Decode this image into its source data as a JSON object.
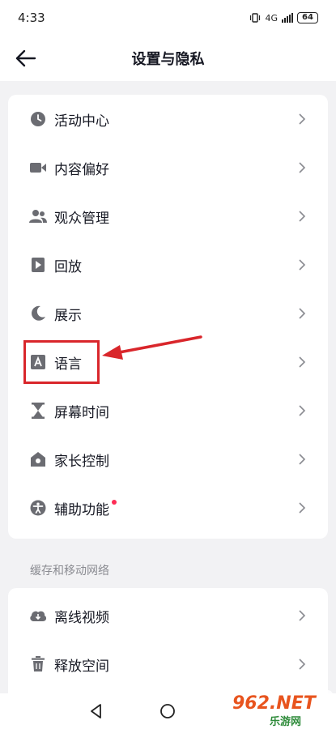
{
  "status_bar": {
    "time": "4:33",
    "network": "4G",
    "battery": "64"
  },
  "header": {
    "title": "设置与隐私"
  },
  "settings_items": [
    {
      "label": "活动中心",
      "icon": "clock-icon"
    },
    {
      "label": "内容偏好",
      "icon": "video-camera-icon"
    },
    {
      "label": "观众管理",
      "icon": "people-icon"
    },
    {
      "label": "回放",
      "icon": "play-icon"
    },
    {
      "label": "展示",
      "icon": "moon-icon"
    },
    {
      "label": "语言",
      "icon": "language-a-icon"
    },
    {
      "label": "屏幕时间",
      "icon": "hourglass-icon"
    },
    {
      "label": "家长控制",
      "icon": "home-icon"
    },
    {
      "label": "辅助功能",
      "icon": "accessibility-icon",
      "badge_dot": true
    }
  ],
  "cache_section": {
    "title": "缓存和移动网络",
    "items": [
      {
        "label": "离线视频",
        "icon": "cloud-download-icon"
      },
      {
        "label": "释放空间",
        "icon": "trash-icon"
      }
    ]
  },
  "watermark": {
    "logo": "962.NET",
    "sub": "乐游网"
  },
  "colors": {
    "accent_red": "#fe2c55",
    "annotation_red": "#d9262b",
    "text": "#161823",
    "icon_gray": "#6b6c72"
  }
}
